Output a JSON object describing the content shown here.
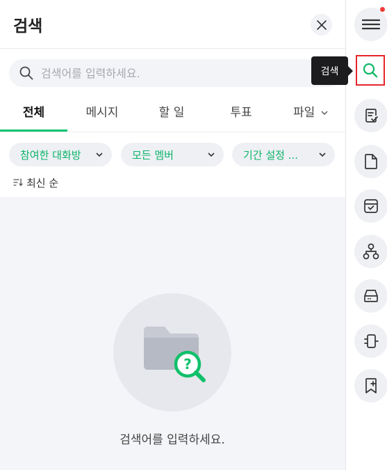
{
  "header": {
    "title": "검색",
    "close_icon": "close-icon"
  },
  "search": {
    "placeholder": "검색어를 입력하세요.",
    "value": "",
    "icon": "search-icon"
  },
  "tabs": [
    {
      "label": "전체",
      "active": true
    },
    {
      "label": "메시지",
      "active": false
    },
    {
      "label": "할 일",
      "active": false
    },
    {
      "label": "투표",
      "active": false
    },
    {
      "label": "파일",
      "active": false
    }
  ],
  "filters": [
    {
      "label": "참여한 대화방"
    },
    {
      "label": "모든 멤버"
    },
    {
      "label": "기간 설정 ..."
    }
  ],
  "sort": {
    "label": "최신 순",
    "icon": "sort-icon"
  },
  "empty_state": {
    "message": "검색어를 입력하세요.",
    "icon": "folder-search-icon"
  },
  "rail": {
    "tooltip": "검색",
    "items": [
      {
        "icon": "menu-icon",
        "has_notification": true
      },
      {
        "icon": "search-icon",
        "active": true
      },
      {
        "icon": "todo-list-icon"
      },
      {
        "icon": "document-icon"
      },
      {
        "icon": "archive-box-icon"
      },
      {
        "icon": "org-chart-icon"
      },
      {
        "icon": "drive-icon"
      },
      {
        "icon": "plugin-icon"
      },
      {
        "icon": "bookmark-icon"
      }
    ]
  },
  "colors": {
    "accent": "#08c26d",
    "chip_text": "#0db46a",
    "highlight_border": "#e5262a",
    "notification": "#f03a3a"
  }
}
